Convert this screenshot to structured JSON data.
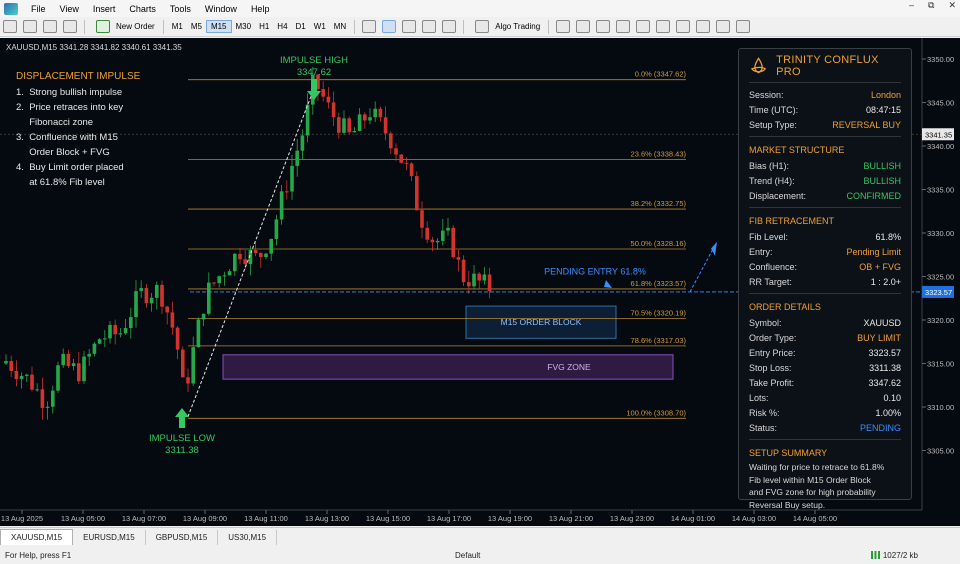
{
  "menu": [
    "File",
    "View",
    "Insert",
    "Charts",
    "Tools",
    "Window",
    "Help"
  ],
  "toolbar": {
    "new_order": "New Order",
    "timeframes": [
      "M1",
      "M5",
      "M15",
      "M30",
      "H1",
      "H4",
      "D1",
      "W1",
      "MN"
    ],
    "active_tf": "M15",
    "algo": "Algo Trading"
  },
  "chart": {
    "header": "XAUUSD,M15  3341.28 3341.82 3340.61 3341.35",
    "current_price_tag": "3341.35",
    "entry_price_tag": "3323.57",
    "annotation": {
      "title": "DISPLACEMENT IMPULSE",
      "steps": [
        "1.  Strong bullish impulse",
        "2.  Price retraces into key",
        "     Fibonacci zone",
        "3.  Confluence with M15",
        "     Order Block + FVG",
        "4.  Buy Limit order placed",
        "     at 61.8% Fib level"
      ]
    },
    "impulse_high": {
      "label": "IMPULSE HIGH",
      "price": "3347.62"
    },
    "impulse_low": {
      "label": "IMPULSE LOW",
      "price": "3311.38"
    },
    "pending_label": "PENDING ENTRY 61.8%",
    "order_block_label": "M15 ORDER BLOCK",
    "fvg_label": "FVG ZONE",
    "fib_levels": [
      {
        "label": "0.0%  (3347.62)",
        "price": 3347.62
      },
      {
        "label": "23.6%  (3338.43)",
        "price": 3338.43
      },
      {
        "label": "38.2%  (3332.75)",
        "price": 3332.75
      },
      {
        "label": "50.0%  (3328.16)",
        "price": 3328.16
      },
      {
        "label": "61.8%  (3323.57)",
        "price": 3323.57
      },
      {
        "label": "70.5%  (3320.19)",
        "price": 3320.19
      },
      {
        "label": "78.6%  (3317.03)",
        "price": 3317.03
      },
      {
        "label": "100.0%  (3308.70)",
        "price": 3308.7
      }
    ],
    "price_axis": [
      "3350.00",
      "3345.00",
      "3340.00",
      "3335.00",
      "3330.00",
      "3325.00",
      "3320.00",
      "3315.00",
      "3310.00",
      "3305.00"
    ],
    "time_axis": [
      "13 Aug 2025",
      "13 Aug 05:00",
      "13 Aug 07:00",
      "13 Aug 09:00",
      "13 Aug 11:00",
      "13 Aug 13:00",
      "13 Aug 15:00",
      "13 Aug 17:00",
      "13 Aug 19:00",
      "13 Aug 21:00",
      "13 Aug 23:00",
      "14 Aug 01:00",
      "14 Aug 03:00",
      "14 Aug 05:00"
    ]
  },
  "panel": {
    "title": "TRINITY CONFLUX PRO",
    "session": [
      {
        "k": "Session:",
        "v": "London",
        "c": "orange"
      },
      {
        "k": "Time (UTC):",
        "v": "08:47:15",
        "c": "white"
      },
      {
        "k": "Setup Type:",
        "v": "REVERSAL BUY",
        "c": "orange"
      }
    ],
    "market_title": "MARKET STRUCTURE",
    "market": [
      {
        "k": "Bias (H1):",
        "v": "BULLISH",
        "c": "green"
      },
      {
        "k": "Trend (H4):",
        "v": "BULLISH",
        "c": "green"
      },
      {
        "k": "Displacement:",
        "v": "CONFIRMED",
        "c": "green"
      }
    ],
    "fib_title": "FIB RETRACEMENT",
    "fib": [
      {
        "k": "Fib Level:",
        "v": "61.8%",
        "c": "white"
      },
      {
        "k": "Entry:",
        "v": "Pending Limit",
        "c": "orange"
      },
      {
        "k": "Confluence:",
        "v": "OB + FVG",
        "c": "orange"
      },
      {
        "k": "RR Target:",
        "v": "1 : 2.0+",
        "c": "white"
      }
    ],
    "order_title": "ORDER DETAILS",
    "order": [
      {
        "k": "Symbol:",
        "v": "XAUUSD",
        "c": "white"
      },
      {
        "k": "Order Type:",
        "v": "BUY LIMIT",
        "c": "orange"
      },
      {
        "k": "Entry Price:",
        "v": "3323.57",
        "c": "white"
      },
      {
        "k": "Stop Loss:",
        "v": "3311.38",
        "c": "white"
      },
      {
        "k": "Take Profit:",
        "v": "3347.62",
        "c": "white"
      },
      {
        "k": "Lots:",
        "v": "0.10",
        "c": "white"
      },
      {
        "k": "Risk %:",
        "v": "1.00%",
        "c": "white"
      },
      {
        "k": "Status:",
        "v": "PENDING",
        "c": "blue"
      }
    ],
    "summary_title": "SETUP SUMMARY",
    "summary_lines": [
      "Waiting for price to retrace to 61.8%",
      "Fib level within M15 Order Block",
      "and FVG zone for high probability",
      "Reversal Buy setup."
    ]
  },
  "tabs": [
    "XAUUSD,M15",
    "EURUSD,M15",
    "GBPUSD,M15",
    "US30,M15"
  ],
  "status": {
    "help": "For Help, press F1",
    "profile": "Default",
    "traffic": "1027/2 kb"
  },
  "colors": {
    "bull": "#26a84a",
    "bear": "#d0342c",
    "fib": "#b8862b",
    "accent": "#f0a030",
    "entry": "#3a8fff"
  }
}
